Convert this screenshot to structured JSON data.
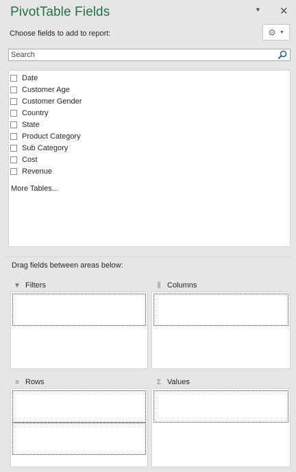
{
  "pane": {
    "title": "PivotTable Fields",
    "choose_label": "Choose fields to add to report:",
    "header_icons": [
      "dropdown-caret-icon",
      "close-icon"
    ],
    "gear_icon": "gear-icon",
    "accent_color": "#217346"
  },
  "search": {
    "placeholder": "Search",
    "value": ""
  },
  "fields": [
    {
      "label": "Date",
      "checked": false
    },
    {
      "label": "Customer Age",
      "checked": false
    },
    {
      "label": "Customer Gender",
      "checked": false
    },
    {
      "label": "Country",
      "checked": false
    },
    {
      "label": "State",
      "checked": false
    },
    {
      "label": "Product Category",
      "checked": false
    },
    {
      "label": "Sub Category",
      "checked": false
    },
    {
      "label": "Cost",
      "checked": false
    },
    {
      "label": "Revenue",
      "checked": false
    }
  ],
  "more_tables": "More Tables...",
  "areas": {
    "drag_label": "Drag fields between areas below:",
    "filters": {
      "label": "Filters",
      "icon": "filter-icon"
    },
    "columns": {
      "label": "Columns",
      "icon": "columns-icon"
    },
    "rows": {
      "label": "Rows",
      "icon": "rows-icon"
    },
    "values": {
      "label": "Values",
      "icon": "sigma-icon"
    }
  }
}
